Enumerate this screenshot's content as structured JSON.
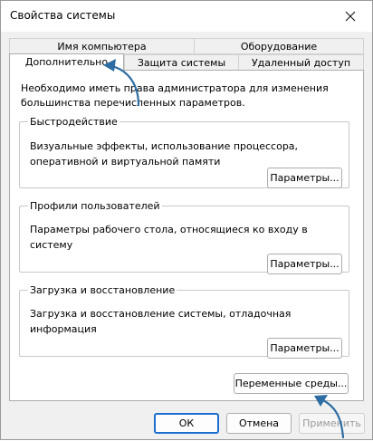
{
  "window": {
    "title": "Свойства системы"
  },
  "tabs": {
    "row1": [
      {
        "label": "Имя компьютера"
      },
      {
        "label": "Оборудование"
      }
    ],
    "row2": [
      {
        "label": "Дополнительно",
        "active": true
      },
      {
        "label": "Защита системы"
      },
      {
        "label": "Удаленный доступ"
      }
    ]
  },
  "panel": {
    "admin_note": "Необходимо иметь права администратора для изменения большинства перечисленных параметров.",
    "groups": [
      {
        "title": "Быстродействие",
        "description": "Визуальные эффекты, использование процессора, оперативной и виртуальной памяти",
        "button": "Параметры..."
      },
      {
        "title": "Профили пользователей",
        "description": "Параметры рабочего стола, относящиеся ко входу в систему",
        "button": "Параметры..."
      },
      {
        "title": "Загрузка и восстановление",
        "description": "Загрузка и восстановление системы, отладочная информация",
        "button": "Параметры..."
      }
    ],
    "env_button": "Переменные среды..."
  },
  "footer": {
    "ok": "ОК",
    "cancel": "Отмена",
    "apply": "Применить"
  },
  "colors": {
    "annotation_arrow": "#2d6da3",
    "default_button_border": "#1a6fcf",
    "disabled_text": "#9a9a9a"
  },
  "icons": {
    "close": "close-icon",
    "arrow": "curved-arrow-annotation"
  }
}
